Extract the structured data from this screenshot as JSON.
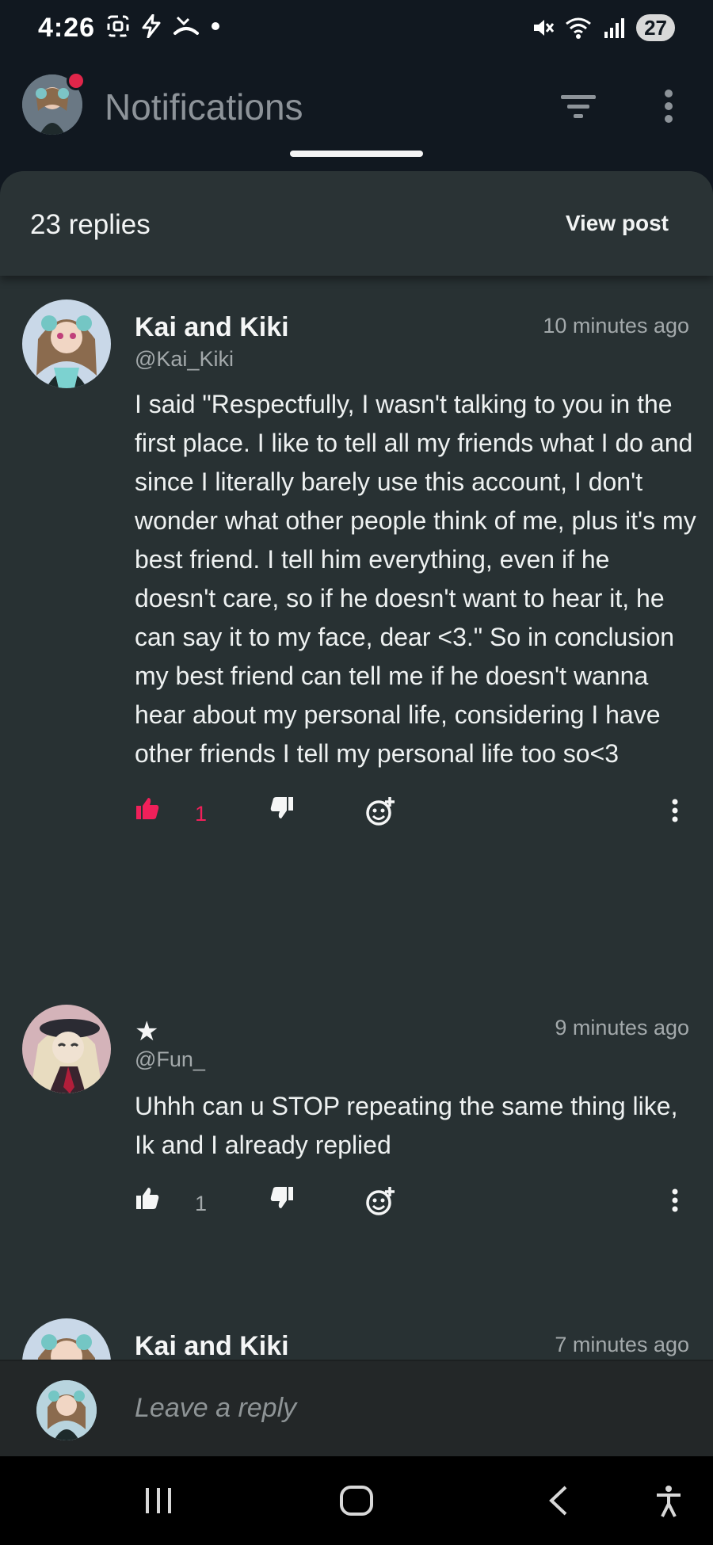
{
  "status": {
    "time": "4:26",
    "battery": "27"
  },
  "header": {
    "title": "Notifications"
  },
  "sheet": {
    "reply_count": "23 replies",
    "view_post": "View post"
  },
  "comments": [
    {
      "name": "Kai and Kiki",
      "handle": "@Kai_Kiki",
      "time": "10 minutes ago",
      "body": "I said \"Respectfully, I wasn't talking to you in the first place. I like to tell all my friends what I do and since I literally barely use this account, I don't wonder what other people think of me, plus it's my best friend. I tell him everything, even if he doesn't care, so if he doesn't want to hear it, he can say it to my face, dear <3.\" So in conclusion my best friend can tell me if he doesn't wanna hear about my personal life, considering I have other friends I tell my personal life too so<3",
      "likes": "1",
      "liked": true,
      "accent": "#f0205a"
    },
    {
      "name": "★",
      "handle": "@Fun_",
      "time": "9 minutes ago",
      "body": "Uhhh can u STOP repeating the same thing like, Ik and I already replied",
      "likes": "1",
      "liked": false
    },
    {
      "name": "Kai and Kiki",
      "time": "7 minutes ago"
    }
  ],
  "reply_bar": {
    "placeholder": "Leave a reply"
  },
  "icons": [
    "screenshot-icon",
    "bolt-icon",
    "missed-call-icon",
    "mute-icon",
    "wifi-icon",
    "signal-icon",
    "filter-icon",
    "more-vertical-icon",
    "thumbs-up-icon",
    "thumbs-down-icon",
    "add-reaction-icon",
    "recents-icon",
    "home-icon",
    "back-icon",
    "accessibility-icon"
  ]
}
